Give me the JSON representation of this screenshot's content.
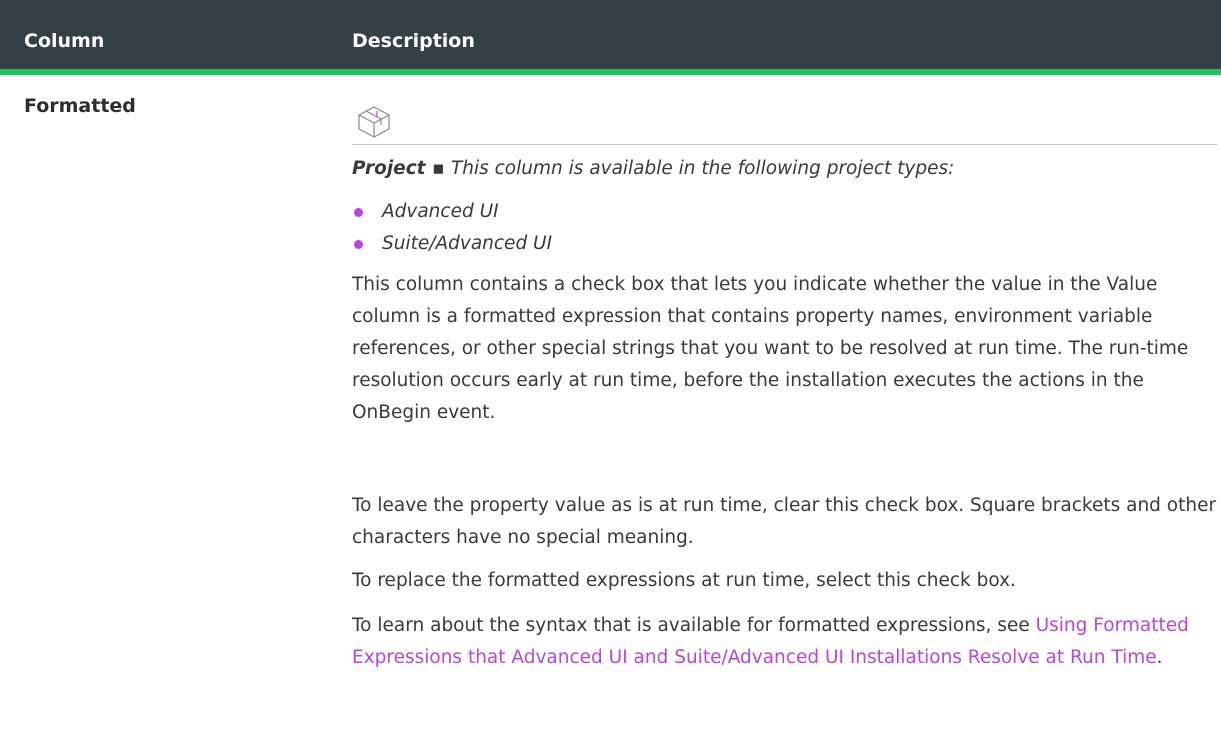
{
  "header": {
    "column_label": "Column",
    "description_label": "Description"
  },
  "row": {
    "name": "Formatted",
    "icon": "project-box-icon",
    "applies_bold": "Project",
    "applies_sep": " ▪ ",
    "applies_text": "This column is available in the following project types:",
    "project_types": [
      "Advanced UI",
      "Suite/Advanced UI"
    ],
    "paragraphs": [
      "This column contains a check box that lets you indicate whether the value in the Value column is a formatted expression that contains property names, environment variable references, or other special strings that you want to be resolved at run time. The run-time resolution occurs early at run time, before the installation executes the actions in the OnBegin event.",
      "To leave the property value as is at run time, clear this check box. Square brackets and other characters have no special meaning.",
      "To replace the formatted expressions at run time, select this check box."
    ],
    "see_prefix": "To learn about the syntax that is available for formatted expressions, see ",
    "see_link": "Using Formatted Expressions that Advanced UI and Suite/Advanced UI Installations Resolve at Run Time",
    "see_suffix": "."
  },
  "colors": {
    "header_bg": "#353f46",
    "accent": "#21c65a",
    "link": "#b745e6",
    "bullet": "#b745e6"
  }
}
